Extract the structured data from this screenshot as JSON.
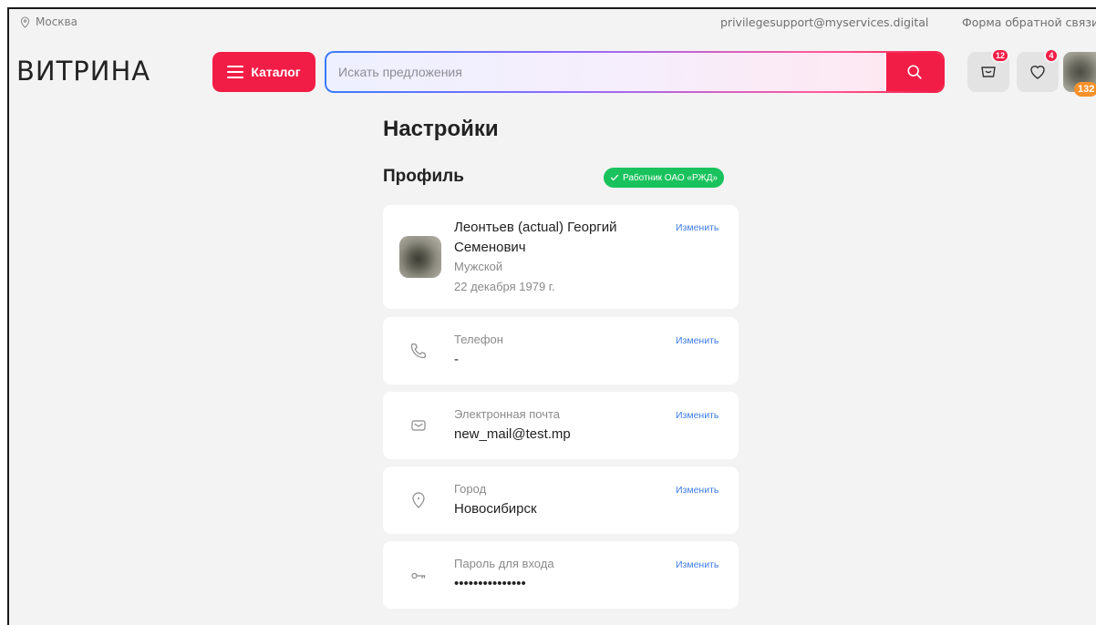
{
  "topbar": {
    "city": "Москва",
    "support_email": "privilegesupport@myservices.digital",
    "feedback": "Форма обратной связи"
  },
  "header": {
    "logo": "ВИТРИНА",
    "catalog_label": "Каталог",
    "search_placeholder": "Искать предложения",
    "cart_count": "12",
    "favorites_count": "4",
    "points": "132"
  },
  "page": {
    "title": "Настройки",
    "section_title": "Профиль",
    "employee_badge": "Работник ОАО «РЖД»"
  },
  "profile": {
    "name": "Леонтьев (actual) Георгий Семенович",
    "gender": "Мужской",
    "birth_date": "22 декабря 1979 г.",
    "edit_label": "Изменить"
  },
  "fields": {
    "phone": {
      "label": "Телефон",
      "value": "-",
      "edit_label": "Изменить"
    },
    "email": {
      "label": "Электронная почта",
      "value": "new_mail@test.mp",
      "edit_label": "Изменить"
    },
    "city": {
      "label": "Город",
      "value": "Новосибирск",
      "edit_label": "Изменить"
    },
    "password": {
      "label": "Пароль для входа",
      "value": "•••••••••••••••",
      "edit_label": "Изменить"
    }
  },
  "colors": {
    "accent": "#f21d46",
    "link": "#3d7be6",
    "success": "#19c25d",
    "points": "#f7902a",
    "background": "#f3f3f3"
  },
  "icons": [
    "location-pin-icon",
    "burger-icon",
    "search-icon",
    "cart-icon",
    "heart-icon",
    "check-icon",
    "phone-icon",
    "mail-icon",
    "key-icon"
  ]
}
